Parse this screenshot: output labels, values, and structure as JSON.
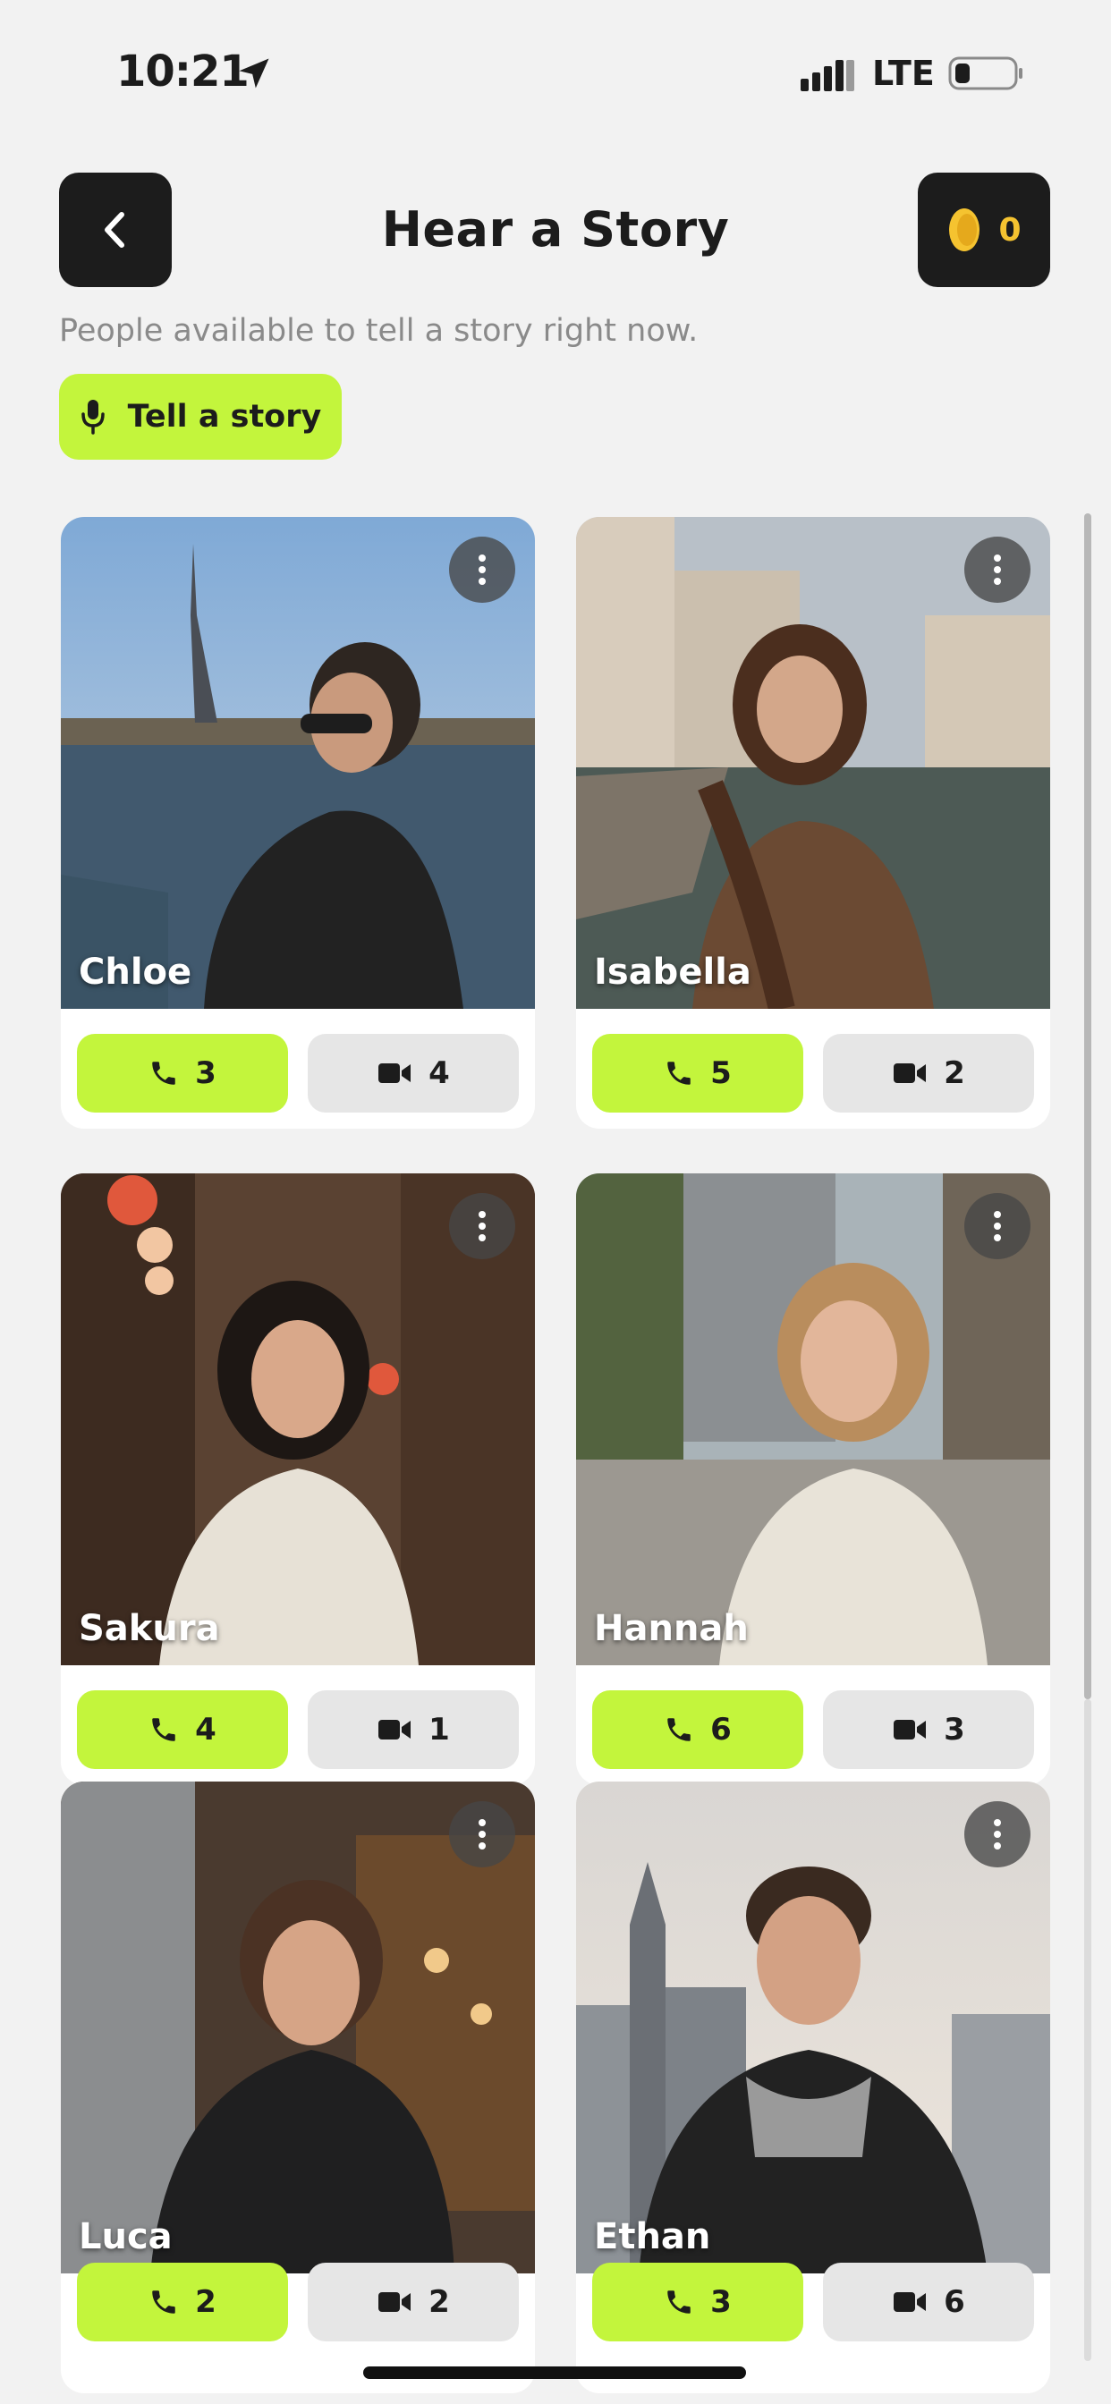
{
  "status_bar": {
    "time": "10:21",
    "network": "LTE",
    "icons": [
      "location-arrow-icon",
      "signal-bars-icon",
      "battery-icon"
    ]
  },
  "header": {
    "title": "Hear a Story",
    "coin_balance": "0",
    "subtitle": "People available to tell a story right now.",
    "tell_story_label": "Tell a story"
  },
  "colors": {
    "accent": "#c3f53c",
    "dark": "#1c1c1c",
    "background": "#f2f2f2",
    "coin": "#f5c330"
  },
  "people": [
    {
      "name": "Chloe",
      "calls": "3",
      "videos": "4"
    },
    {
      "name": "Isabella",
      "calls": "5",
      "videos": "2"
    },
    {
      "name": "Sakura",
      "calls": "4",
      "videos": "1"
    },
    {
      "name": "Hannah",
      "calls": "6",
      "videos": "3"
    },
    {
      "name": "Luca",
      "calls": "2",
      "videos": "2"
    },
    {
      "name": "Ethan",
      "calls": "3",
      "videos": "6"
    }
  ]
}
